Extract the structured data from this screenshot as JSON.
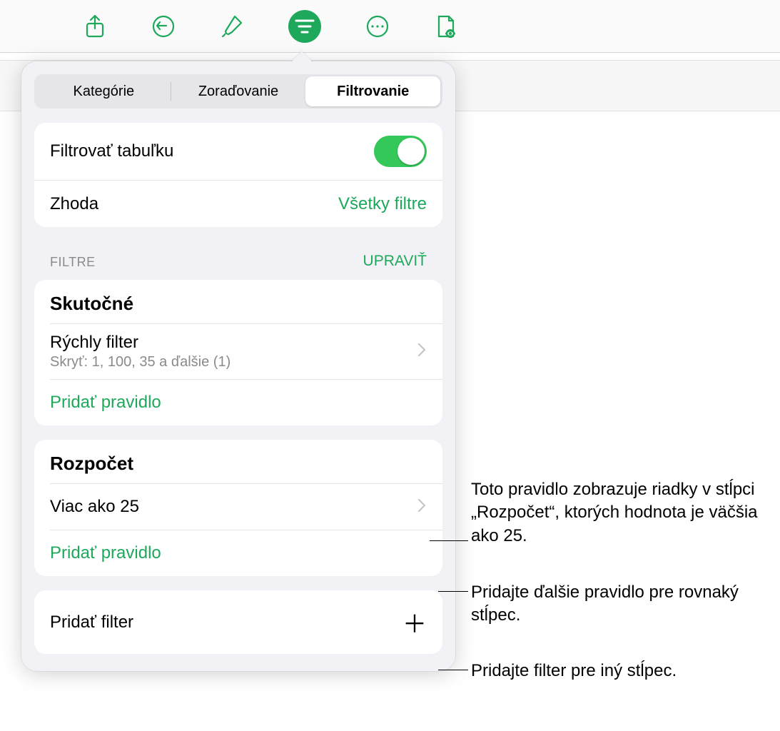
{
  "toolbar": {
    "icons": [
      "share-icon",
      "undo-icon",
      "format-brush-icon",
      "filter-icon",
      "more-icon",
      "document-view-icon"
    ],
    "active_index": 3
  },
  "tabs": {
    "items": [
      "Kategórie",
      "Zoraďovanie",
      "Filtrovanie"
    ],
    "active_index": 2
  },
  "top_card": {
    "filter_table_label": "Filtrovať tabuľku",
    "filter_table_on": true,
    "match_label": "Zhoda",
    "match_value": "Všetky filtre"
  },
  "section": {
    "header_label": "FILTRE",
    "header_action": "UPRAVIŤ"
  },
  "groups": [
    {
      "title": "Skutočné",
      "rules": [
        {
          "primary": "Rýchly filter",
          "secondary": "Skryť: 1, 100, 35 a ďalšie (1)"
        }
      ],
      "add_rule_label": "Pridať pravidlo"
    },
    {
      "title": "Rozpočet",
      "rules": [
        {
          "primary": "Viac ako 25",
          "secondary": ""
        }
      ],
      "add_rule_label": "Pridať pravidlo"
    }
  ],
  "add_filter_label": "Pridať filter",
  "callouts": {
    "rule_desc": "Toto pravidlo zobrazuje riadky v stĺpci „Rozpočet“, ktorých hodnota je väčšia ako 25.",
    "add_rule_desc": "Pridajte ďalšie pravidlo pre rovnaký stĺpec.",
    "add_filter_desc": "Pridajte filter pre iný stĺpec."
  }
}
